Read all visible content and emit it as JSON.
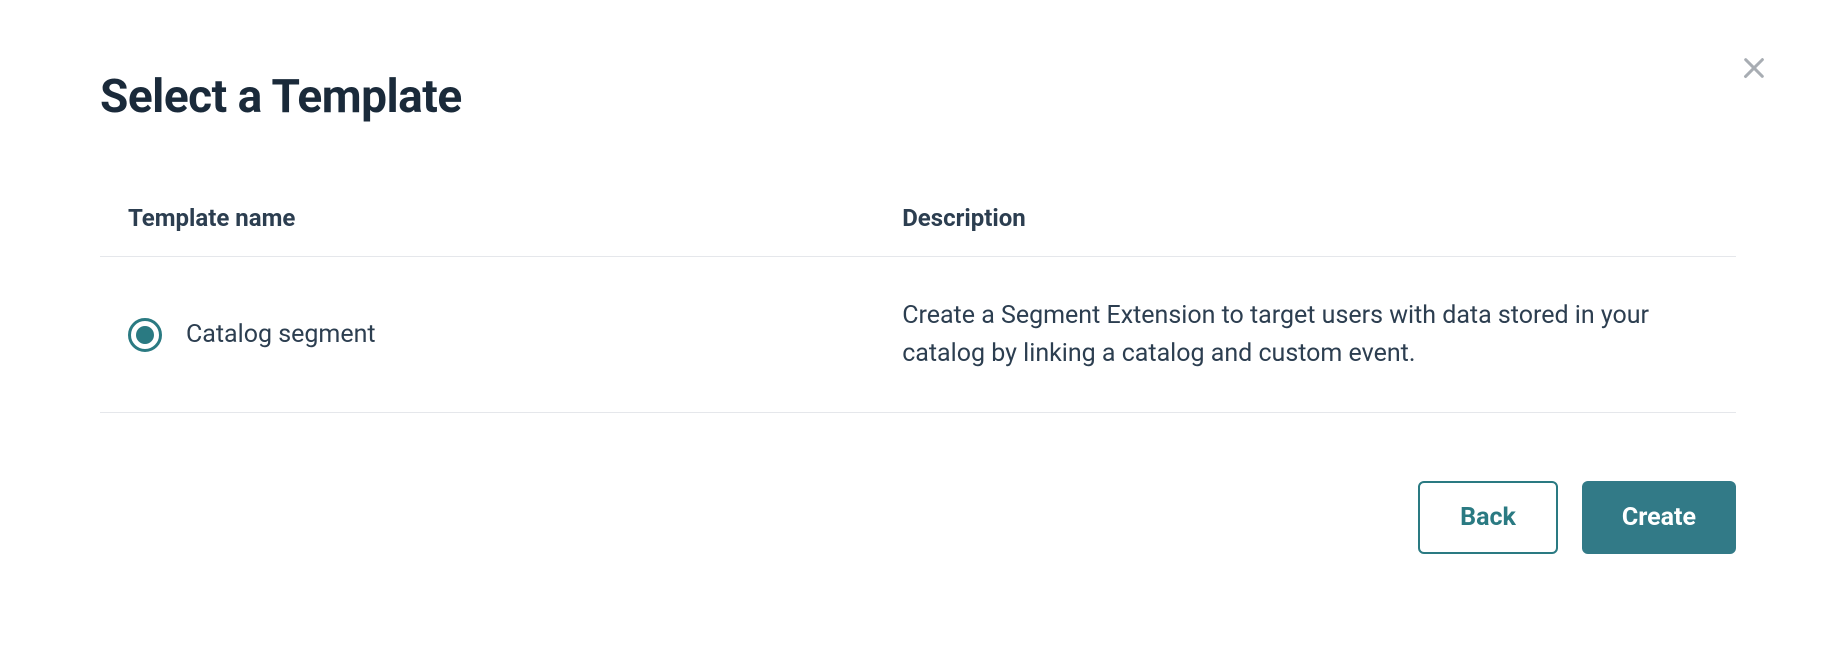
{
  "modal": {
    "title": "Select a Template",
    "close_label": "Close"
  },
  "table": {
    "headers": {
      "name": "Template name",
      "description": "Description"
    },
    "rows": [
      {
        "name": "Catalog segment",
        "description": "Create a Segment Extension to target users with data stored in your catalog by linking a catalog and custom event.",
        "selected": true
      }
    ]
  },
  "footer": {
    "back_label": "Back",
    "create_label": "Create"
  },
  "colors": {
    "accent": "#2a7a82",
    "primary_btn": "#327a87",
    "text": "#1a2a3a",
    "muted": "#a8adb3",
    "border": "#e5e7eb"
  }
}
